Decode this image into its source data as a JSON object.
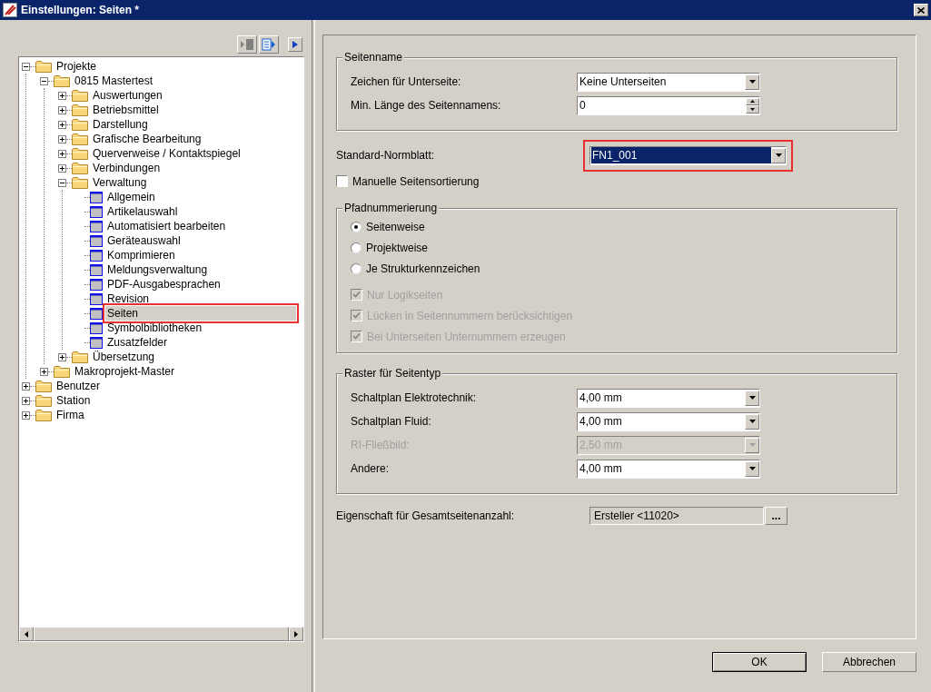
{
  "window": {
    "title": "Einstellungen: Seiten *"
  },
  "tree": [
    {
      "label": "Projekte",
      "kind": "folder",
      "expanded": true,
      "selected": false,
      "highlighted": false,
      "children": [
        {
          "label": "0815 Mastertest",
          "kind": "folder",
          "expanded": true,
          "selected": false,
          "highlighted": false,
          "children": [
            {
              "label": "Auswertungen",
              "kind": "folder",
              "expanded": false,
              "selected": false,
              "highlighted": false
            },
            {
              "label": "Betriebsmittel",
              "kind": "folder",
              "expanded": false,
              "selected": false,
              "highlighted": false
            },
            {
              "label": "Darstellung",
              "kind": "folder",
              "expanded": false,
              "selected": false,
              "highlighted": false
            },
            {
              "label": "Grafische Bearbeitung",
              "kind": "folder",
              "expanded": false,
              "selected": false,
              "highlighted": false
            },
            {
              "label": "Querverweise / Kontaktspiegel",
              "kind": "folder",
              "expanded": false,
              "selected": false,
              "highlighted": false
            },
            {
              "label": "Verbindungen",
              "kind": "folder",
              "expanded": false,
              "selected": false,
              "highlighted": false
            },
            {
              "label": "Verwaltung",
              "kind": "folder",
              "expanded": true,
              "selected": false,
              "highlighted": false,
              "children": [
                {
                  "label": "Allgemein",
                  "kind": "page",
                  "selected": false,
                  "highlighted": false
                },
                {
                  "label": "Artikelauswahl",
                  "kind": "page",
                  "selected": false,
                  "highlighted": false
                },
                {
                  "label": "Automatisiert bearbeiten",
                  "kind": "page",
                  "selected": false,
                  "highlighted": false
                },
                {
                  "label": "Geräteauswahl",
                  "kind": "page",
                  "selected": false,
                  "highlighted": false
                },
                {
                  "label": "Komprimieren",
                  "kind": "page",
                  "selected": false,
                  "highlighted": false
                },
                {
                  "label": "Meldungsverwaltung",
                  "kind": "page",
                  "selected": false,
                  "highlighted": false
                },
                {
                  "label": "PDF-Ausgabesprachen",
                  "kind": "page",
                  "selected": false,
                  "highlighted": false
                },
                {
                  "label": "Revision",
                  "kind": "page",
                  "selected": false,
                  "highlighted": false
                },
                {
                  "label": "Seiten",
                  "kind": "page",
                  "selected": true,
                  "highlighted": true
                },
                {
                  "label": "Symbolbibliotheken",
                  "kind": "page",
                  "selected": false,
                  "highlighted": false
                },
                {
                  "label": "Zusatzfelder",
                  "kind": "page",
                  "selected": false,
                  "highlighted": false
                }
              ]
            },
            {
              "label": "Übersetzung",
              "kind": "folder",
              "expanded": false,
              "selected": false,
              "highlighted": false
            }
          ]
        },
        {
          "label": "Makroprojekt-Master",
          "kind": "folder",
          "expanded": false,
          "selected": false,
          "highlighted": false
        }
      ]
    },
    {
      "label": "Benutzer",
      "kind": "folder",
      "expanded": false,
      "selected": false,
      "highlighted": false
    },
    {
      "label": "Station",
      "kind": "folder",
      "expanded": false,
      "selected": false,
      "highlighted": false
    },
    {
      "label": "Firma",
      "kind": "folder",
      "expanded": false,
      "selected": false,
      "highlighted": false
    }
  ],
  "seitenname": {
    "title": "Seitenname",
    "rows": [
      {
        "kind": "dropdown",
        "label": "Zeichen für Unterseite:",
        "value": "Keine Unterseiten",
        "disabled": false
      },
      {
        "kind": "spin",
        "label": "Min. Länge des Seitennamens:",
        "value": "0",
        "disabled": false
      }
    ]
  },
  "normblatt": {
    "label": "Standard-Normblatt:",
    "value": "FN1_001",
    "highlighted": true
  },
  "manual_sort": {
    "label": "Manuelle Seitensortierung",
    "checked": false,
    "disabled": false
  },
  "pfad": {
    "title": "Pfadnummerierung",
    "radios": [
      {
        "label": "Seitenweise",
        "selected": true
      },
      {
        "label": "Projektweise",
        "selected": false
      },
      {
        "label": "Je Strukturkennzeichen",
        "selected": false
      }
    ],
    "checks": [
      {
        "label": "Nur Logikseiten",
        "checked": true,
        "disabled": true
      },
      {
        "label": "Lücken in Seitennummern berücksichtigen",
        "checked": true,
        "disabled": true
      },
      {
        "label": "Bei Unterseiten Unternummern erzeugen",
        "checked": true,
        "disabled": true
      }
    ]
  },
  "raster": {
    "title": "Raster für Seitentyp",
    "rows": [
      {
        "kind": "dropdown",
        "label": "Schaltplan Elektrotechnik:",
        "value": "4,00 mm",
        "disabled": false
      },
      {
        "kind": "dropdown",
        "label": "Schaltplan Fluid:",
        "value": "4,00 mm",
        "disabled": false
      },
      {
        "kind": "dropdown",
        "label": "RI-Fließbild:",
        "value": "2,50 mm",
        "disabled": true
      },
      {
        "kind": "dropdown",
        "label": "Andere:",
        "value": "4,00 mm",
        "disabled": false
      }
    ]
  },
  "gesamt": {
    "label": "Eigenschaft für Gesamtseitenanzahl:",
    "value": "Ersteller <11020>",
    "button": "..."
  },
  "buttons": [
    "OK",
    "Abbrechen"
  ]
}
